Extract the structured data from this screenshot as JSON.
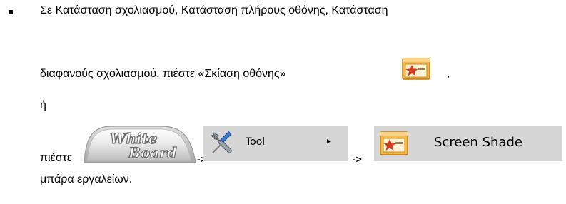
{
  "paragraph": {
    "line1": "Σε Κατάσταση σχολιασμού, Κατάσταση πλήρους οθόνης, Κατάσταση",
    "line2": "διαφανούς σχολιασμού, πιέστε «Σκίαση οθόνης»",
    "line2_end": ",",
    "line3": "ή",
    "press_label": "πιέστε",
    "arrow1": "->",
    "arrow2": "->",
    "line_last": "μπάρα εργαλείων."
  },
  "whiteboard_button": {
    "line1": "White",
    "line2": "Board"
  },
  "tool_menu_item": {
    "label": "Tool",
    "submenu_glyph": "►",
    "icon": "tools-icon"
  },
  "screen_shade_menu_item": {
    "label": "Screen Shade",
    "icon": "screen-shade-icon"
  },
  "colors": {
    "menu_bg": "#d6d6d6",
    "whiteboard_grey": "#8c8c8c",
    "shade_frame_orange": "#f0a830",
    "shade_star_red": "#d03020"
  }
}
